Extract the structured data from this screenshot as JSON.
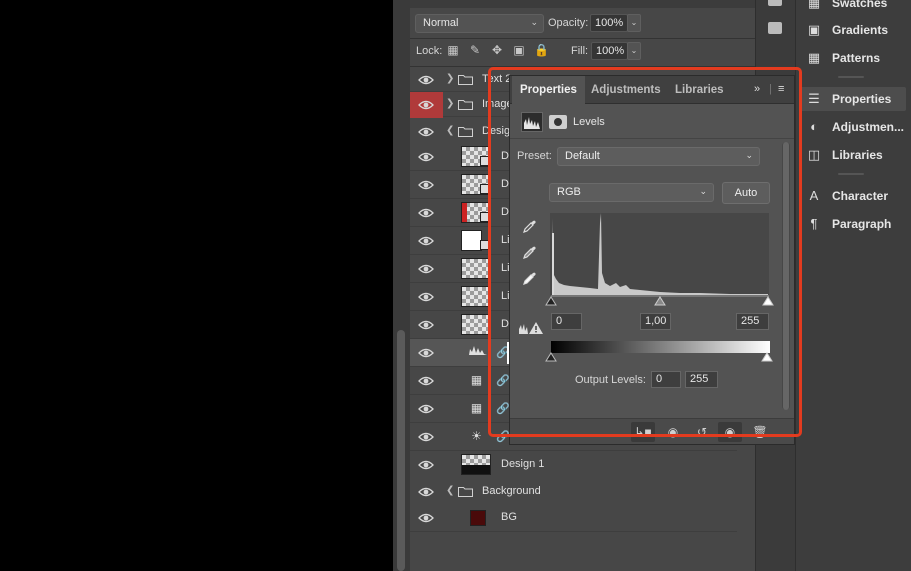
{
  "layers_panel": {
    "blend_mode": "Normal",
    "opacity_label": "Opacity:",
    "opacity_value": "100%",
    "lock_label": "Lock:",
    "fill_label": "Fill:",
    "fill_value": "100%",
    "rows": [
      {
        "name": "Text 2",
        "kind": "group"
      },
      {
        "name": "Image",
        "kind": "group"
      },
      {
        "name": "Design",
        "kind": "group-open"
      },
      {
        "name": "D",
        "kind": "smart"
      },
      {
        "name": "D",
        "kind": "smart"
      },
      {
        "name": "D",
        "kind": "smart"
      },
      {
        "name": "Li",
        "kind": "smart"
      },
      {
        "name": "Li",
        "kind": "layer"
      },
      {
        "name": "Li",
        "kind": "layer"
      },
      {
        "name": "D",
        "kind": "layer"
      },
      {
        "name": "",
        "kind": "adjustment-levels"
      },
      {
        "name": "",
        "kind": "adjustment"
      },
      {
        "name": "",
        "kind": "adjustment"
      },
      {
        "name": "",
        "kind": "adjustment-brightness"
      },
      {
        "name": "Design 1",
        "kind": "layer"
      },
      {
        "name": "Background",
        "kind": "group-open"
      },
      {
        "name": "BG",
        "kind": "fill"
      }
    ]
  },
  "dock": {
    "items": [
      {
        "label": "Swatches",
        "icon": "swatches-icon"
      },
      {
        "label": "Gradients",
        "icon": "gradients-icon"
      },
      {
        "label": "Patterns",
        "icon": "patterns-icon"
      },
      {
        "label": "Properties",
        "icon": "properties-icon"
      },
      {
        "label": "Adjustmen...",
        "icon": "adjustments-icon"
      },
      {
        "label": "Libraries",
        "icon": "libraries-icon"
      },
      {
        "label": "Character",
        "icon": "character-icon"
      },
      {
        "label": "Paragraph",
        "icon": "paragraph-icon"
      }
    ]
  },
  "properties": {
    "tabs": [
      "Properties",
      "Adjustments",
      "Libraries"
    ],
    "panel_title": "Levels",
    "preset_label": "Preset:",
    "preset_value": "Default",
    "channel_value": "RGB",
    "auto_label": "Auto",
    "input_black": "0",
    "input_mid": "1,00",
    "input_white": "255",
    "output_label": "Output Levels:",
    "output_black": "0",
    "output_white": "255"
  },
  "colors": {
    "highlight": "#e33b1f",
    "active_eye_bg": "#b03a3a",
    "bg_fill": "#4a0a0a"
  }
}
